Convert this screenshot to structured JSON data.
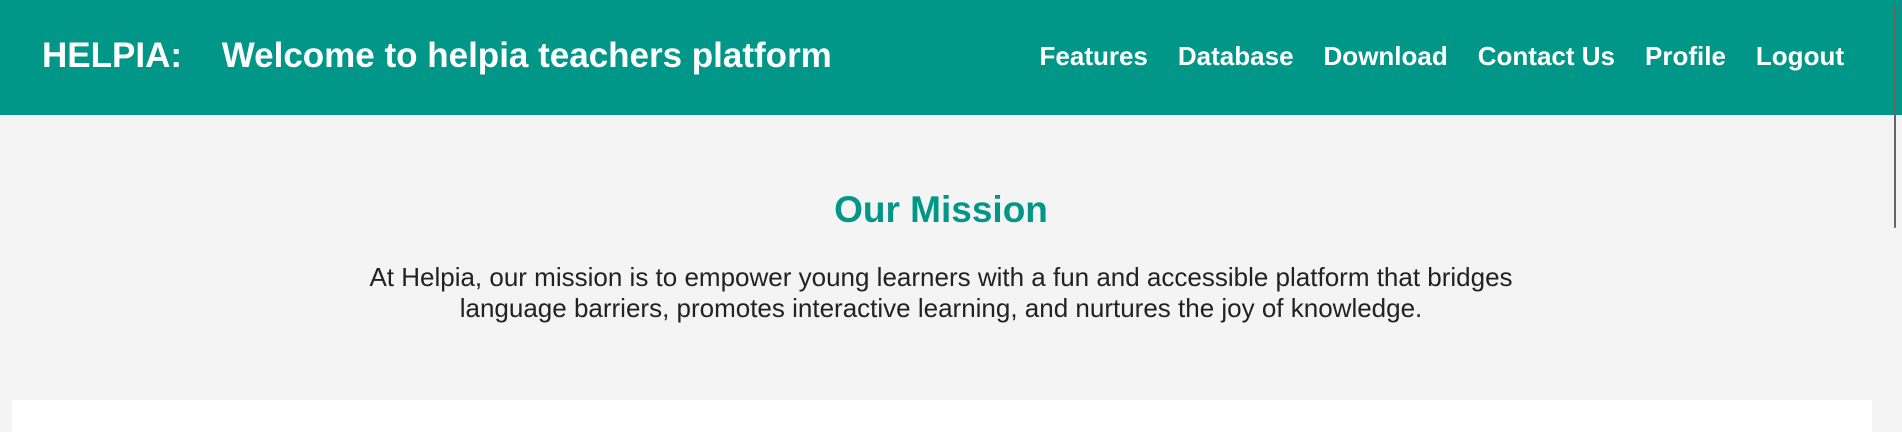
{
  "header": {
    "brand": "HELPIA:",
    "title": "Welcome to helpia teachers platform",
    "nav": {
      "features": "Features",
      "database": "Database",
      "download": "Download",
      "contact": "Contact Us",
      "profile": "Profile",
      "logout": "Logout"
    }
  },
  "mission": {
    "title": "Our Mission",
    "line1": "At Helpia, our mission is to empower young learners with a fun and accessible platform that bridges",
    "line2": "language barriers, promotes interactive learning, and nurtures the joy of knowledge."
  },
  "colors": {
    "brand": "#009688",
    "page_background": "#f4f4f4",
    "text": "#222222"
  }
}
